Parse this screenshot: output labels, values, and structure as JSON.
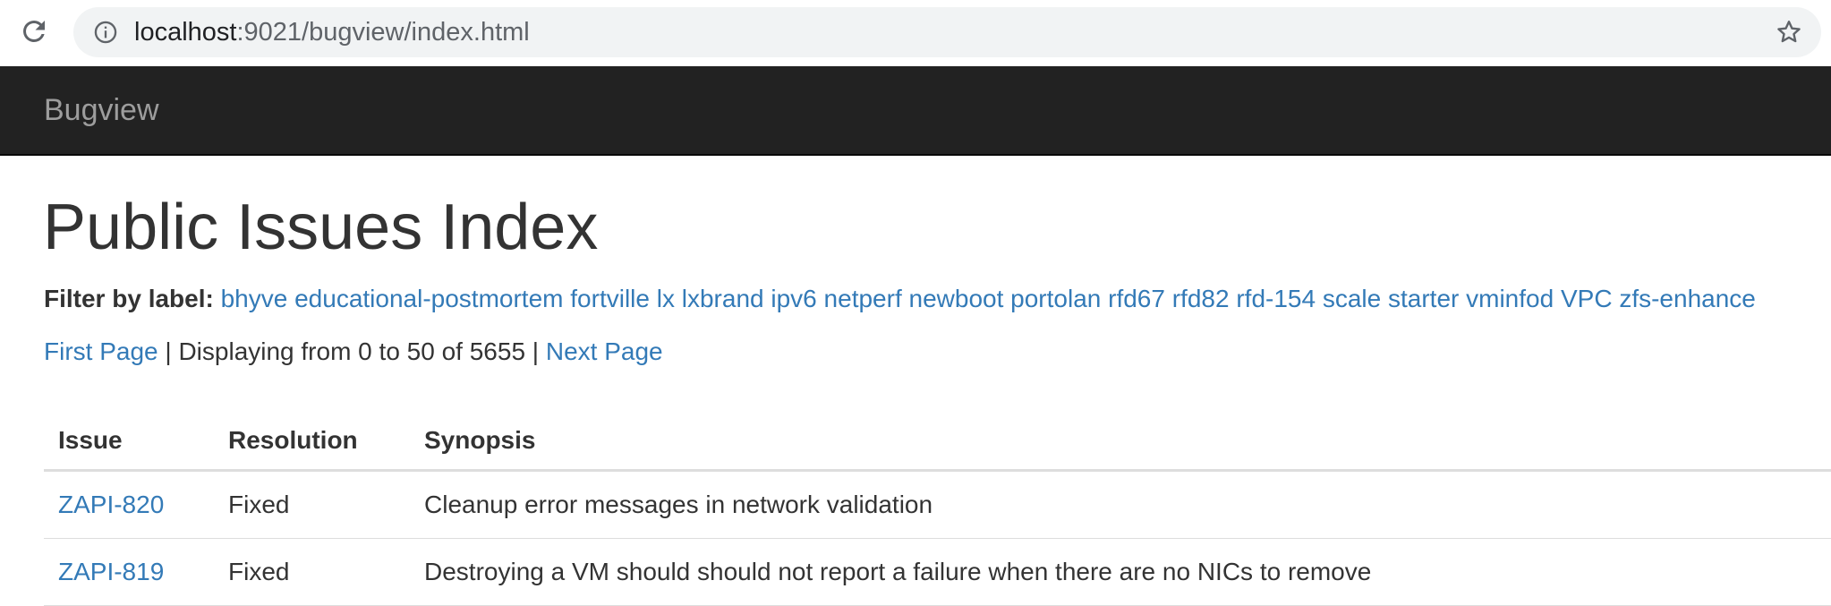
{
  "browser": {
    "url_host": "localhost",
    "url_rest": ":9021/bugview/index.html"
  },
  "navbar": {
    "brand": "Bugview"
  },
  "page": {
    "title": "Public Issues Index"
  },
  "filter": {
    "label": "Filter by label:",
    "labels": [
      "bhyve",
      "educational-postmortem",
      "fortville",
      "lx",
      "lxbrand",
      "ipv6",
      "netperf",
      "newboot",
      "portolan",
      "rfd67",
      "rfd82",
      "rfd-154",
      "scale",
      "starter",
      "vminfod",
      "VPC",
      "zfs-enhance"
    ]
  },
  "pager": {
    "first_page": "First Page",
    "separator": " | ",
    "displaying": "Displaying from 0 to 50 of 5655",
    "next_page": "Next Page"
  },
  "table": {
    "headers": [
      "Issue",
      "Resolution",
      "Synopsis"
    ],
    "rows": [
      {
        "issue": "ZAPI-820",
        "resolution": "Fixed",
        "synopsis": "Cleanup error messages in network validation"
      },
      {
        "issue": "ZAPI-819",
        "resolution": "Fixed",
        "synopsis": "Destroying a VM should should not report a failure when there are no NICs to remove"
      }
    ]
  },
  "colors": {
    "link": "#337ab7",
    "navbar_bg": "#222222",
    "brand_text": "#9d9d9d",
    "text": "#333333"
  },
  "icons": [
    "reload-icon",
    "info-icon",
    "star-icon"
  ]
}
